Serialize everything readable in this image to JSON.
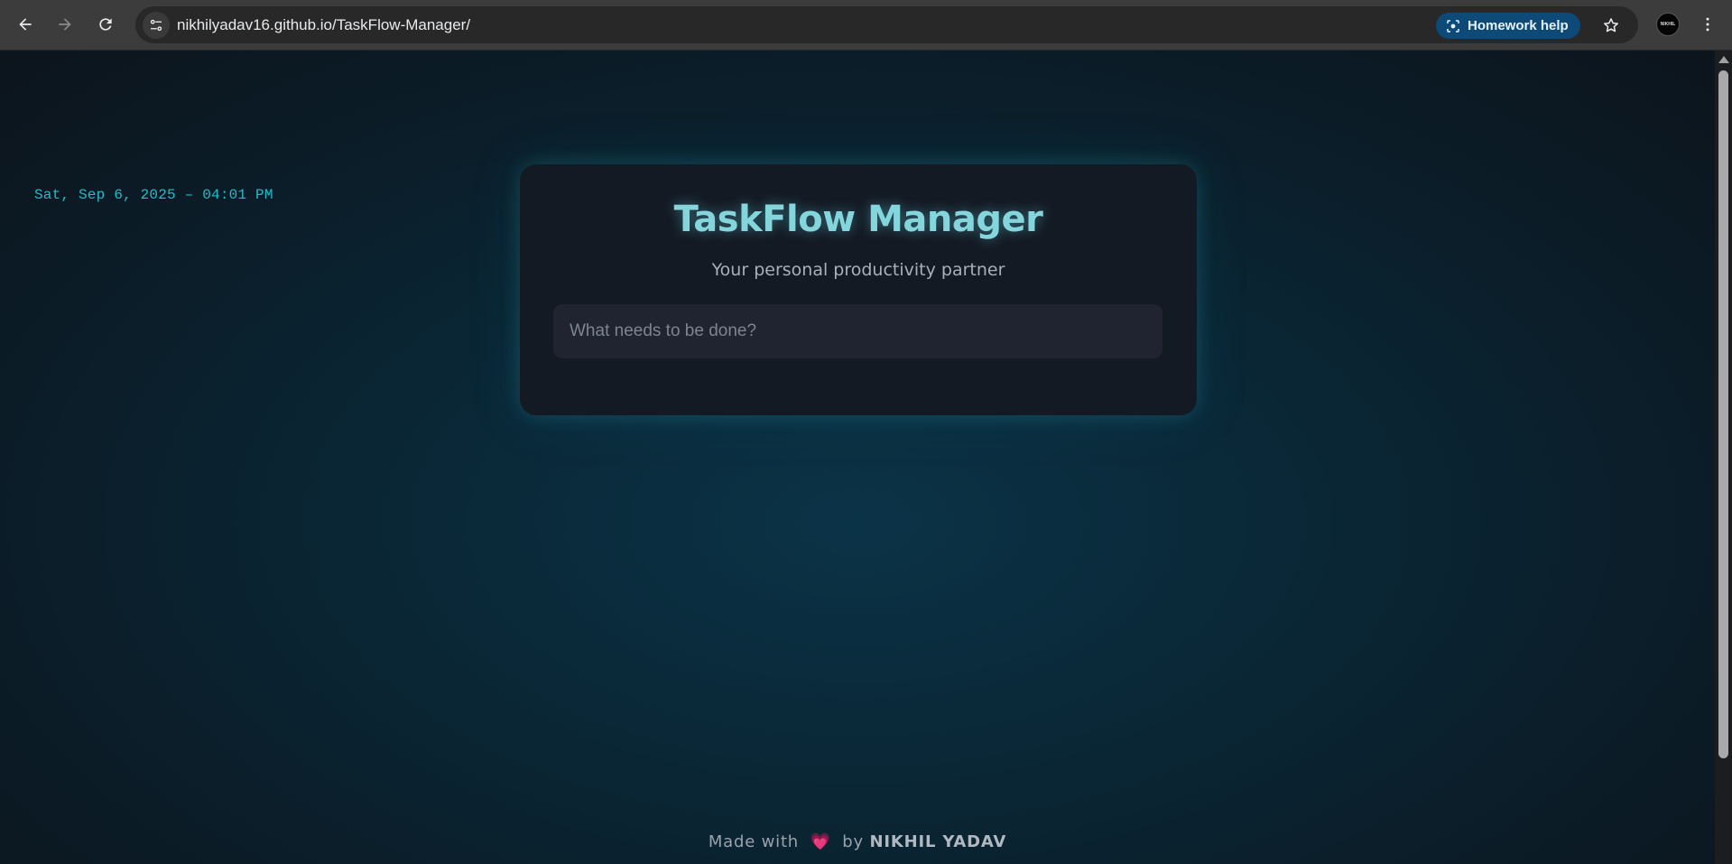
{
  "browser": {
    "url": "nikhilyadav16.github.io/TaskFlow-Manager/",
    "homework_label": "Homework help",
    "profile_initials": "NIKHIL"
  },
  "page": {
    "datetime": "Sat, Sep 6, 2025 – 04:01 PM",
    "title": "TaskFlow Manager",
    "subtitle": "Your personal productivity partner",
    "input_placeholder": "What needs to be done?",
    "input_value": "",
    "footer": {
      "made_with": "Made with",
      "heart": "💗",
      "by": "by",
      "author": "NIKHIL YADAV"
    }
  },
  "colors": {
    "accent": "#84d6dc",
    "datetime": "#22bccb",
    "card_bg": "#141a24",
    "heart": "#ff4d7d"
  },
  "icons": [
    "back-icon",
    "forward-icon",
    "reload-icon",
    "site-info-icon",
    "lens-icon",
    "star-icon",
    "more-vert-icon"
  ]
}
